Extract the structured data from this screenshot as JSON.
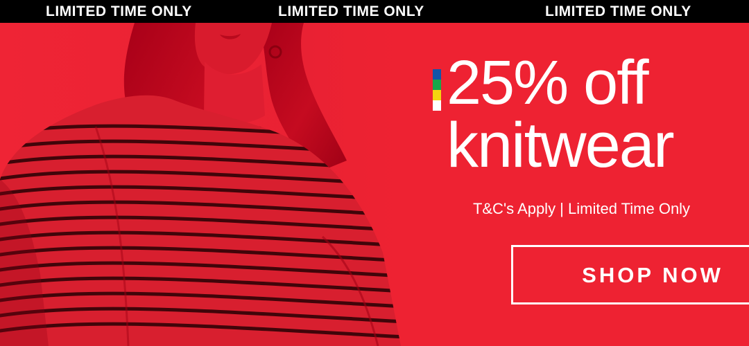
{
  "ticker": {
    "messages": [
      "LIMITED TIME ONLY",
      "LIMITED TIME ONLY",
      "LIMITED TIME ONLY"
    ]
  },
  "promo": {
    "headline_line1": "25% off",
    "headline_line2": "knitwear",
    "subtext": "T&C's Apply | Limited Time Only",
    "cta_label": "SHOP NOW"
  },
  "brand_colors": {
    "background": "#ee2232",
    "ticker": "#000000",
    "text": "#ffffff",
    "accent_blue": "#1355a8",
    "accent_green": "#17a74a",
    "accent_yellow": "#f4d40f",
    "accent_white": "#ffffff"
  }
}
